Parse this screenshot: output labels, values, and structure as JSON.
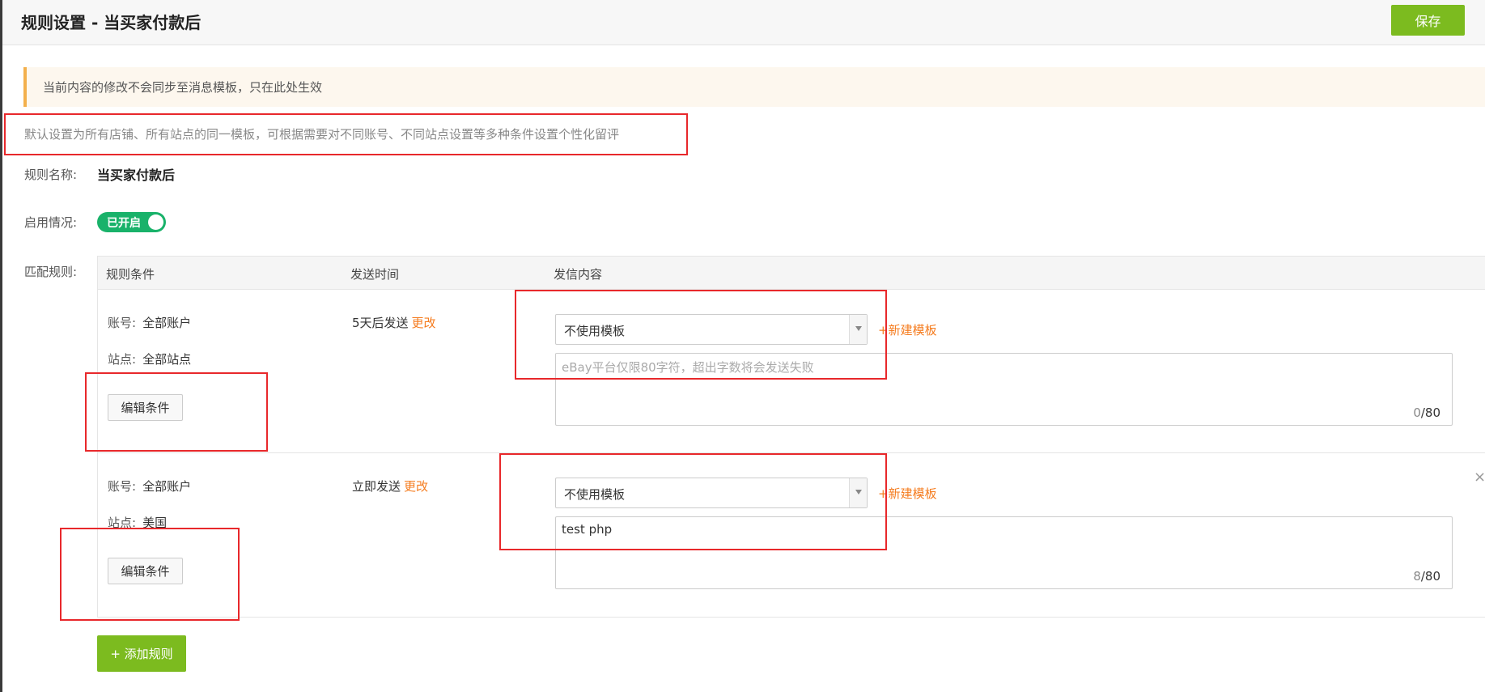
{
  "header": {
    "title": "规则设置 - 当买家付款后",
    "save_label": "保存"
  },
  "notice": {
    "text": "当前内容的修改不会同步至消息模板，只在此处生效"
  },
  "description": "默认设置为所有店铺、所有站点的同一模板，可根据需要对不同账号、不同站点设置等多种条件设置个性化留评",
  "form": {
    "rule_name_label": "规则名称:",
    "rule_name_value": "当买家付款后",
    "status_label": "启用情况:",
    "status_toggle_text": "已开启",
    "status_enabled": true,
    "match_label": "匹配规则:"
  },
  "table": {
    "headers": {
      "condition": "规则条件",
      "send_time": "发送时间",
      "content": "发信内容"
    },
    "rules": [
      {
        "account_label": "账号:",
        "account_value": "全部账户",
        "site_label": "站点:",
        "site_value": "全部站点",
        "edit_label": "编辑条件",
        "send_time": "5天后发送",
        "change_label": "更改",
        "template_selected": "不使用模板",
        "new_template_label": "+新建模板",
        "content_text": "",
        "content_placeholder": "eBay平台仅限80字符，超出字数将会发送失败",
        "count_current": "0",
        "count_max": "/80"
      },
      {
        "account_label": "账号:",
        "account_value": "全部账户",
        "site_label": "站点:",
        "site_value": "美国",
        "edit_label": "编辑条件",
        "send_time": "立即发送",
        "change_label": "更改",
        "template_selected": "不使用模板",
        "new_template_label": "+新建模板",
        "content_text": "test php",
        "count_current": "8",
        "count_max": "/80",
        "remove_symbol": "×"
      }
    ]
  },
  "add_rule_label": "+ 添加规则",
  "colors": {
    "primary_green": "#7cbb1f",
    "toggle_green": "#19b26a",
    "link_orange": "#f57c1f",
    "notice_bar": "#f3b04c",
    "highlight_red": "#e8282b"
  }
}
